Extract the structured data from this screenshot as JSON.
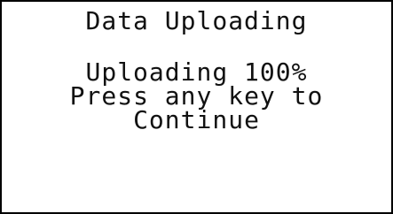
{
  "display": {
    "title": "Data Uploading",
    "lines": [
      "Uploading 100%",
      "Press any key to",
      "Continue"
    ]
  },
  "colors": {
    "background": "#ffffff",
    "text": "#111111",
    "border": "#000000"
  }
}
